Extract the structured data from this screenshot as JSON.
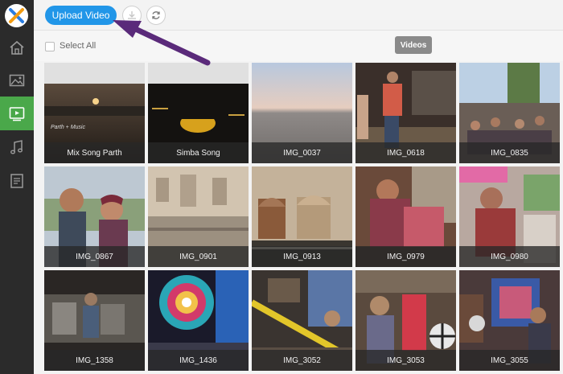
{
  "toolbar": {
    "upload_label": "Upload Video",
    "select_all_label": "Select All",
    "videos_tooltip": "Videos"
  },
  "sidebar": {
    "items": [
      {
        "icon": "home-icon",
        "active": false
      },
      {
        "icon": "image-icon",
        "active": false
      },
      {
        "icon": "video-icon",
        "active": true
      },
      {
        "icon": "music-icon",
        "active": false
      },
      {
        "icon": "document-icon",
        "active": false
      }
    ]
  },
  "colors": {
    "accent": "#2196e8",
    "active_nav": "#4aa84a",
    "sidebar_bg": "#2b2b2b",
    "arrow": "#5a2a7a"
  },
  "grid": {
    "tiles": [
      {
        "title": "Mix Song Parth",
        "overlay_text": "Parth + Music"
      },
      {
        "title": "Simba Song"
      },
      {
        "title": "IMG_0037"
      },
      {
        "title": "IMG_0618"
      },
      {
        "title": "IMG_0835"
      },
      {
        "title": "IMG_0867"
      },
      {
        "title": "IMG_0901"
      },
      {
        "title": "IMG_0913"
      },
      {
        "title": "IMG_0979"
      },
      {
        "title": "IMG_0980"
      },
      {
        "title": "IMG_1358"
      },
      {
        "title": "IMG_1436"
      },
      {
        "title": "IMG_3052"
      },
      {
        "title": "IMG_3053"
      },
      {
        "title": "IMG_3055"
      }
    ]
  }
}
